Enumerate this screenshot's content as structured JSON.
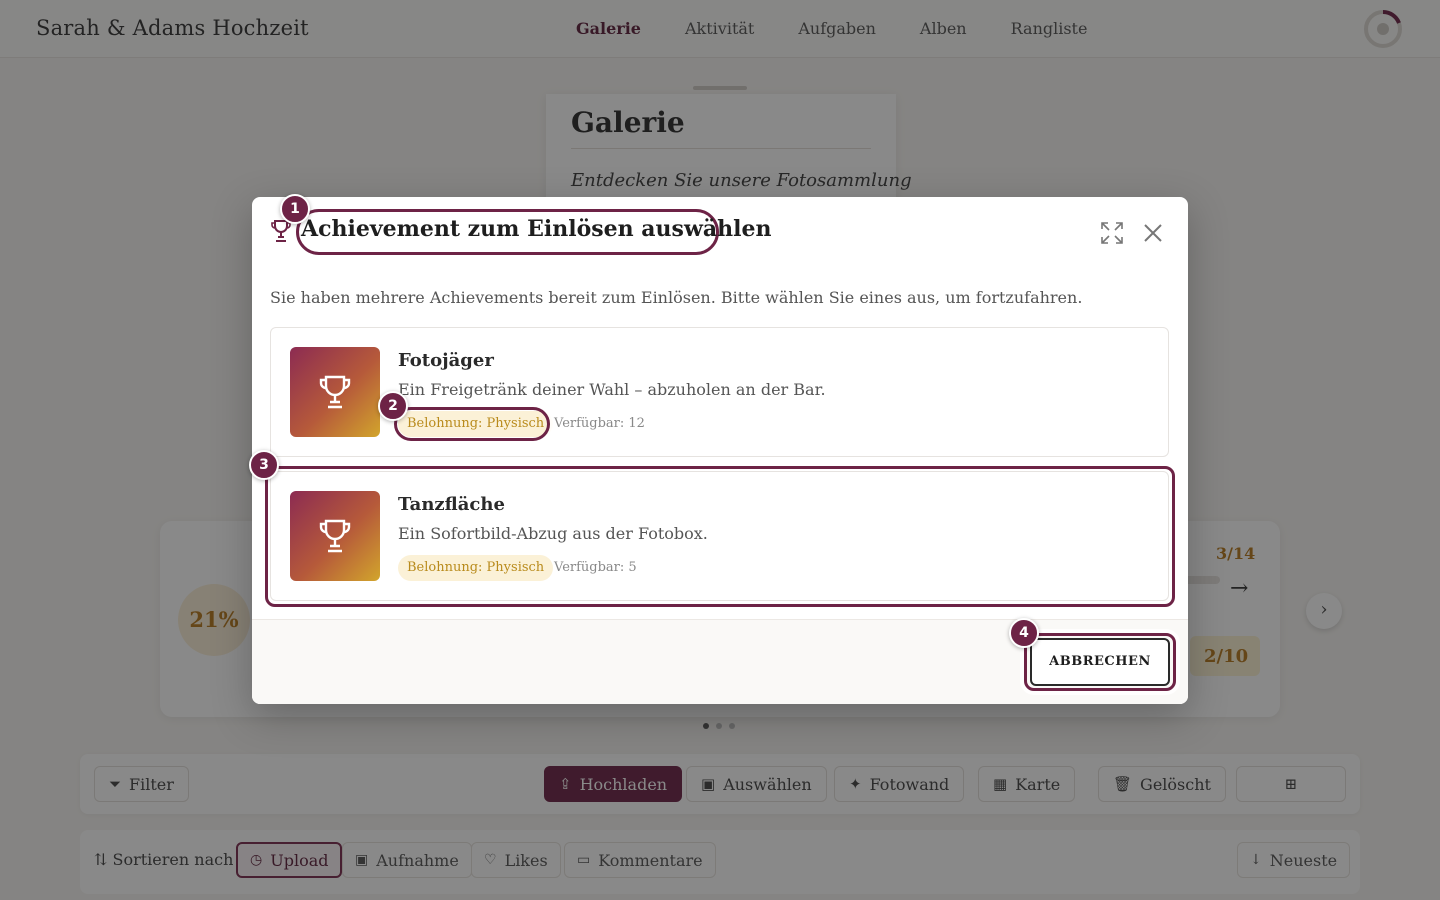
{
  "app": {
    "brand": "Sarah & Adams Hochzeit",
    "nav": [
      "Galerie",
      "Aktivität",
      "Aufgaben",
      "Alben",
      "Rangliste"
    ],
    "active_nav": "Galerie"
  },
  "hero": {
    "title": "Galerie",
    "subtitle": "Entdecken Sie unsere Fotosammlung"
  },
  "stats": {
    "percent": "21%",
    "progress_a": "3/14",
    "progress_b": "2/10"
  },
  "toolbar": {
    "filter": "Filter",
    "upload": "Hochladen",
    "select": "Auswählen",
    "photowall": "Fotowand",
    "map": "Karte",
    "deleted": "Gelöscht"
  },
  "sort": {
    "label": "Sortieren nach",
    "options": [
      "Upload",
      "Aufnahme",
      "Likes",
      "Kommentare"
    ],
    "active": "Upload",
    "order": "Neueste"
  },
  "modal": {
    "title": "Achievement zum Einlösen auswählen",
    "description": "Sie haben mehrere Achievements bereit zum Einlösen. Bitte wählen Sie eines aus, um fortzufahren.",
    "achievements": [
      {
        "name": "Fotojäger",
        "text": "Ein Freigetränk deiner Wahl – abzuholen an der Bar.",
        "badge": "Belohnung: Physisch",
        "available": "Verfügbar: 12"
      },
      {
        "name": "Tanzfläche",
        "text": "Ein Sofortbild-Abzug aus der Fotobox.",
        "badge": "Belohnung: Physisch",
        "available": "Verfügbar: 5"
      }
    ],
    "cancel": "ABBRECHEN"
  },
  "markers": [
    "1",
    "2",
    "3",
    "4"
  ],
  "colors": {
    "accent": "#6d2346",
    "gold": "#b7781c",
    "badge_bg": "#fbf1d7",
    "overlay": "rgba(20,20,20,0.50)"
  }
}
